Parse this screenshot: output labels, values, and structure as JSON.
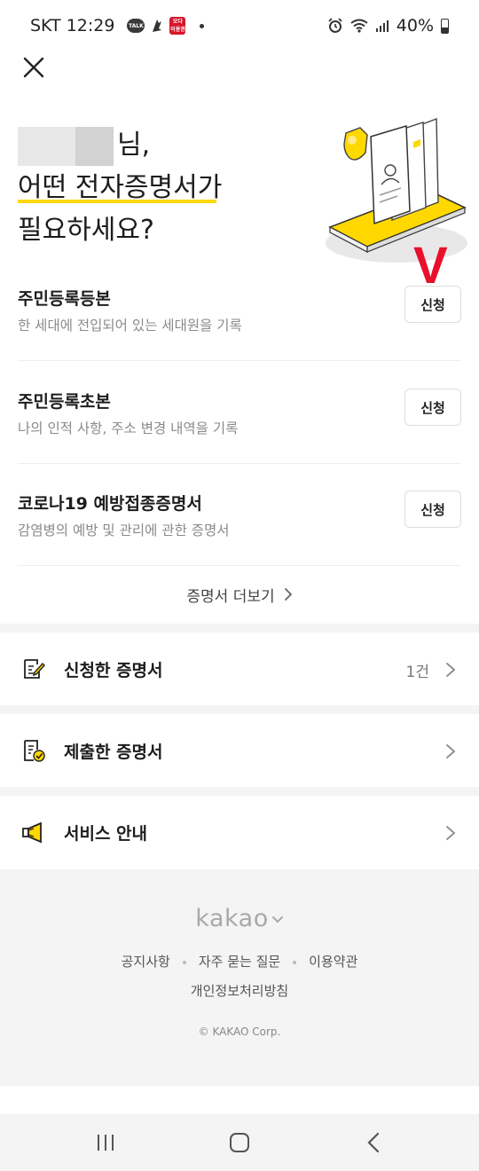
{
  "status_bar": {
    "carrier_time": "SKT 12:29",
    "talk_badge": "TALK",
    "red_app_badge": "모다\n이용권",
    "battery": "40%"
  },
  "header": {
    "close_icon": "close-icon"
  },
  "greeting": {
    "name_suffix": "님,",
    "line2": "어떤 전자증명서가",
    "line3": "필요하세요?"
  },
  "annotation_mark": "V",
  "certificates": [
    {
      "title": "주민등록등본",
      "desc": "한 세대에 전입되어 있는 세대원을 기록",
      "button": "신청"
    },
    {
      "title": "주민등록초본",
      "desc": "나의 인적 사항, 주소 변경 내역을 기록",
      "button": "신청"
    },
    {
      "title": "코로나19 예방접종증명서",
      "desc": "감염병의 예방 및 관리에 관한 증명서",
      "button": "신청"
    }
  ],
  "more_link": "증명서 더보기",
  "menu": [
    {
      "label": "신청한 증명서",
      "count": "1건",
      "icon": "edit-document-icon"
    },
    {
      "label": "제출한 증명서",
      "count": "",
      "icon": "submitted-document-icon"
    },
    {
      "label": "서비스 안내",
      "count": "",
      "icon": "megaphone-icon"
    }
  ],
  "footer": {
    "logo": "kakao",
    "links": [
      "공지사항",
      "자주 묻는 질문",
      "이용약관"
    ],
    "privacy": "개인정보처리방침",
    "copyright": "© KAKAO Corp."
  },
  "colors": {
    "accent_yellow": "#ffd800",
    "annotation_red": "#e8102b",
    "section_gap": "#f4f4f4"
  }
}
